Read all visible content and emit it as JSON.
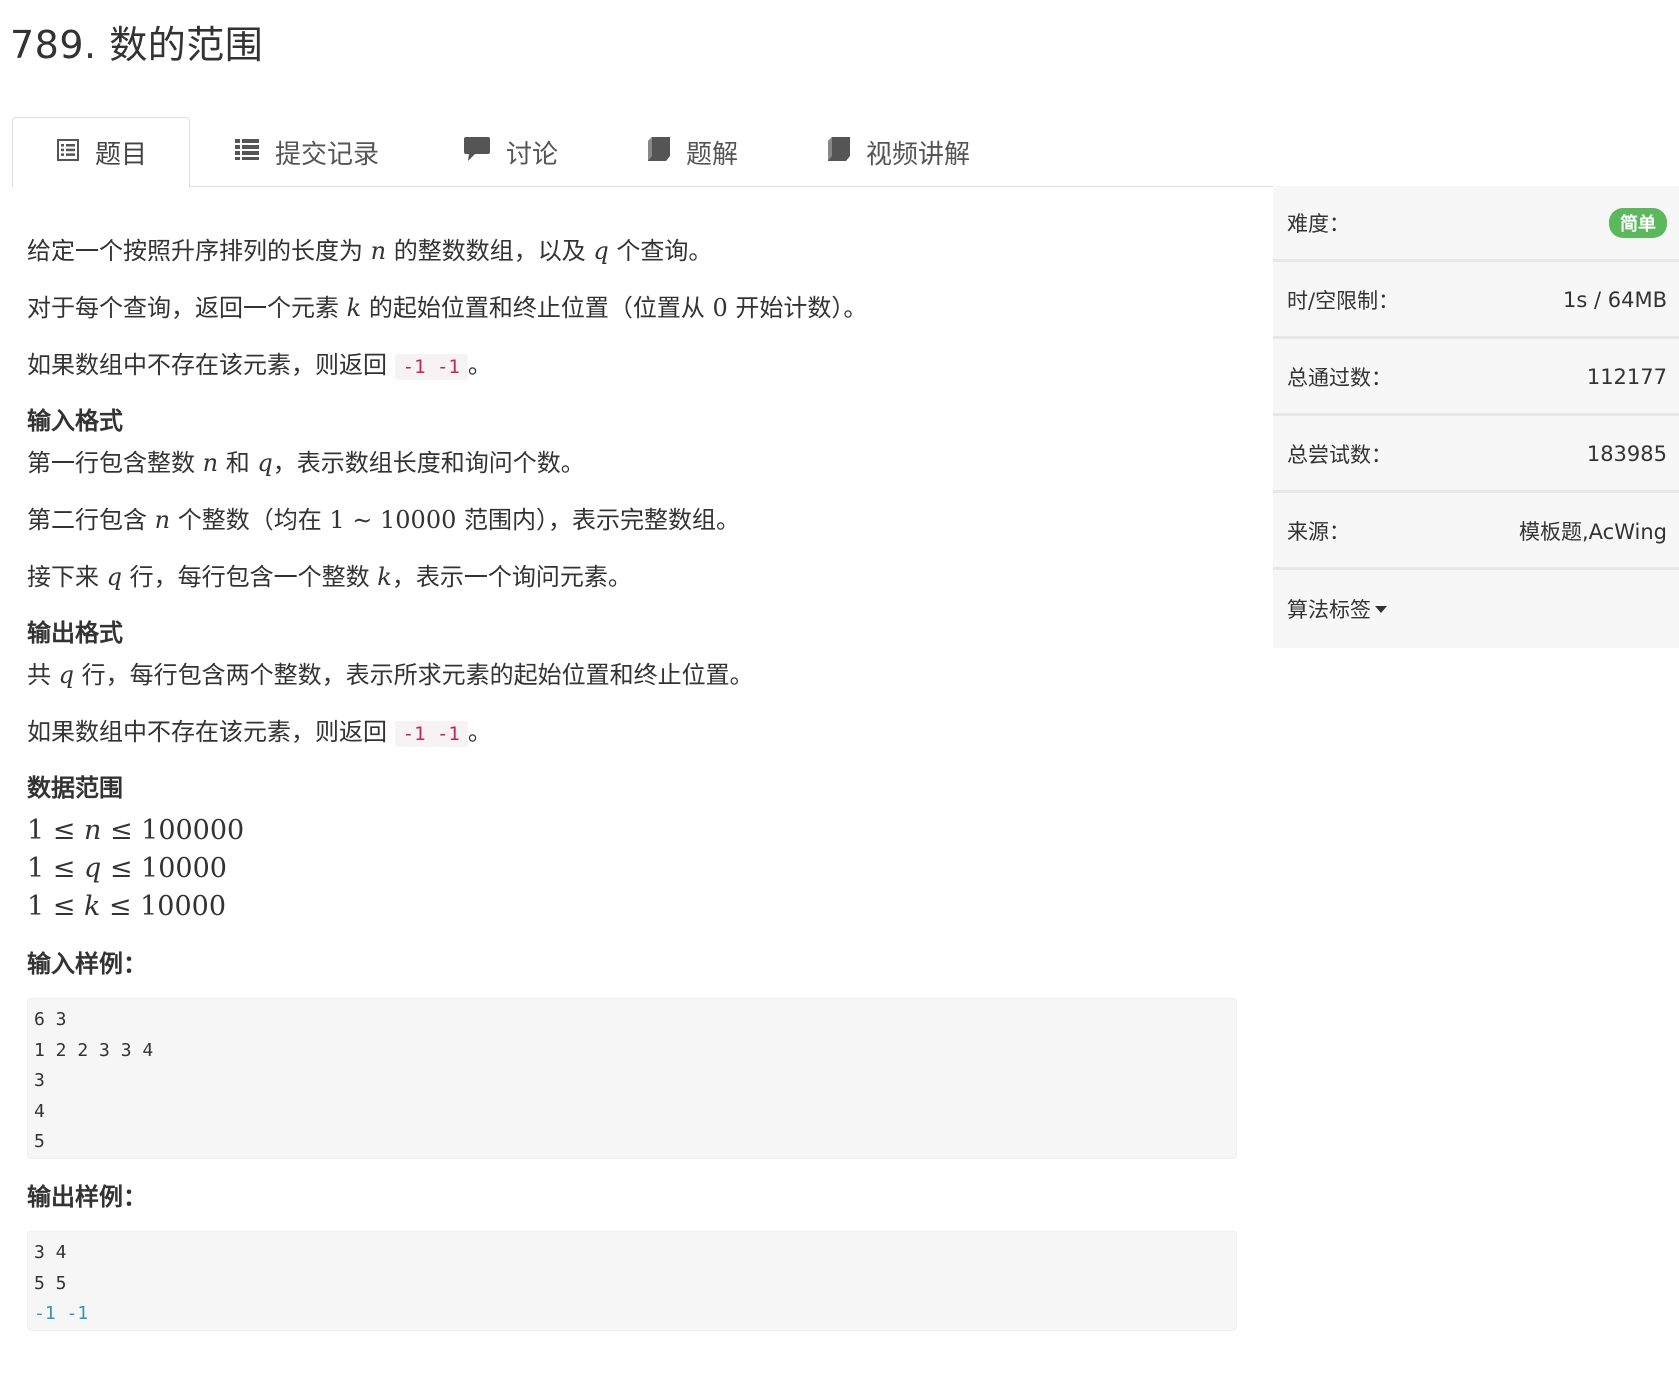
{
  "problem": {
    "title": "789. 数的范围"
  },
  "tabs": [
    {
      "label": "题目",
      "icon": "list-alt-icon"
    },
    {
      "label": "提交记录",
      "icon": "list-icon"
    },
    {
      "label": "讨论",
      "icon": "comment-icon"
    },
    {
      "label": "题解",
      "icon": "book-icon"
    },
    {
      "label": "视频讲解",
      "icon": "book-icon"
    }
  ],
  "statement": {
    "p1": [
      "给定一个按照升序排列的长度为 ",
      "n",
      " 的整数数组，以及 ",
      "q",
      " 个查询。"
    ],
    "p2": [
      "对于每个查询，返回一个元素 ",
      "k",
      " 的起始位置和终止位置（位置从 ",
      "0",
      " 开始计数）。"
    ],
    "p3": [
      "如果数组中不存在该元素，则返回 ",
      "-1 -1",
      "。"
    ]
  },
  "input_format": {
    "heading": "输入格式",
    "l1": [
      "第一行包含整数 ",
      "n",
      " 和 ",
      "q",
      "，表示数组长度和询问个数。"
    ],
    "l2": [
      "第二行包含 ",
      "n",
      " 个整数（均在 ",
      "1 ∼ 10000",
      " 范围内），表示完整数组。"
    ],
    "l3": [
      "接下来 ",
      "q",
      " 行，每行包含一个整数 ",
      "k",
      "，表示一个询问元素。"
    ]
  },
  "output_format": {
    "heading": "输出格式",
    "l1": [
      "共 ",
      "q",
      " 行，每行包含两个整数，表示所求元素的起始位置和终止位置。"
    ],
    "l2": [
      "如果数组中不存在该元素，则返回 ",
      "-1 -1",
      "。"
    ]
  },
  "data_range": {
    "heading": "数据范围",
    "lines": [
      [
        "1 ≤ ",
        "n",
        " ≤ 100000"
      ],
      [
        "1 ≤ ",
        "q",
        " ≤ 10000"
      ],
      [
        "1 ≤ ",
        "k",
        " ≤ 10000"
      ]
    ]
  },
  "sample_input": {
    "heading": "输入样例：",
    "lines": [
      "6 3",
      "1 2 2 3 3 4",
      "3",
      "4",
      "5"
    ]
  },
  "sample_output": {
    "heading": "输出样例：",
    "lines": [
      "3 4",
      "5 5",
      "-1 -1"
    ]
  },
  "sidebar": {
    "difficulty_label": "难度：",
    "difficulty_value": "简单",
    "limit_label": "时/空限制：",
    "limit_value": "1s / 64MB",
    "passed_label": "总通过数：",
    "passed_value": "112177",
    "tried_label": "总尝试数：",
    "tried_value": "183985",
    "source_label": "来源：",
    "source_value": "模板题,AcWing",
    "tags_label": "算法标签"
  },
  "colors": {
    "badge_green": "#5cb85c",
    "inline_code_red": "#c7254e",
    "output_blue": "#3592c4"
  }
}
